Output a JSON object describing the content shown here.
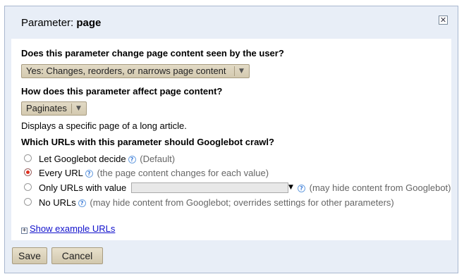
{
  "dialog": {
    "title_prefix": "Parameter:",
    "title_param": "page",
    "close_glyph": "✕"
  },
  "q1": {
    "label": "Does this parameter change page content seen by the user?",
    "selected": "Yes: Changes, reorders, or narrows page content"
  },
  "q2": {
    "label": "How does this parameter affect page content?",
    "selected": "Paginates",
    "description": "Displays a specific page of a long article."
  },
  "q3": {
    "label": "Which URLs with this parameter should Googlebot crawl?",
    "options": [
      {
        "label": "Let Googlebot decide",
        "hint": "(Default)",
        "checked": false
      },
      {
        "label": "Every URL",
        "hint": "(the page content changes for each value)",
        "checked": true
      },
      {
        "label": "Only URLs with value",
        "hint": "(may hide content from Googlebot)",
        "checked": false
      },
      {
        "label": "No URLs",
        "hint": "(may hide content from Googlebot; overrides settings for other parameters)",
        "checked": false
      }
    ]
  },
  "show_examples": {
    "label": "Show example URLs",
    "icon": "expand-plus-icon"
  },
  "buttons": {
    "save": "Save",
    "cancel": "Cancel"
  },
  "icons": {
    "help": "?",
    "dropdown_arrow": "▼"
  },
  "colors": {
    "dialog_bg": "#e8eef7",
    "button_bg": "#dcd3bd",
    "link": "#1111cc",
    "radio_checked": "#e03020"
  }
}
